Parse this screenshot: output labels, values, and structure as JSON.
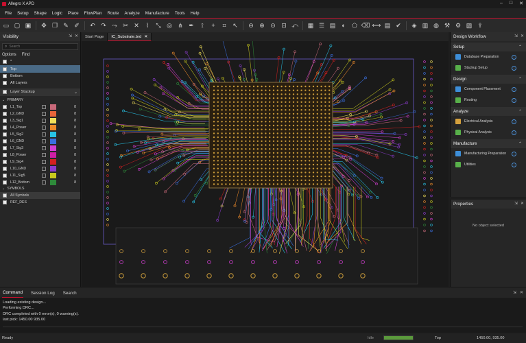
{
  "app": {
    "title": "Allegro X APD"
  },
  "menu": [
    "File",
    "Setup",
    "Shape",
    "Logic",
    "Place",
    "FlowPlan",
    "Route",
    "Analyze",
    "Manufacture",
    "Tools",
    "Help"
  ],
  "toolbar": {
    "icons": [
      "folder-open-icon",
      "new-file-icon",
      "save-icon",
      "move-icon",
      "copy-icon",
      "edit-icon",
      "draw-icon",
      "undo-icon",
      "redo-icon",
      "route-icon",
      "cut-icon",
      "delete-icon",
      "connect-icon",
      "slide-icon",
      "via-icon",
      "spread-icon",
      "pen-icon",
      "fanout-icon",
      "add-icon",
      "snap-icon",
      "cursor-icon",
      "zoom-out-icon",
      "zoom-in-icon",
      "zoom-fit-icon",
      "zoom-window-icon",
      "zoom-previous-icon",
      "grid-icon",
      "layers-icon",
      "film-icon",
      "color-icon",
      "shape-icon",
      "delete-shape-icon",
      "measure-icon",
      "report-icon",
      "drc-icon",
      "3d-icon",
      "chip-icon",
      "palette-icon",
      "tools-icon",
      "settings-icon",
      "script-icon",
      "export-icon"
    ]
  },
  "visibility": {
    "title": "Visibility",
    "search_placeholder": "Search",
    "tabs": [
      "Options",
      "Find"
    ],
    "rows": [
      {
        "label": "*",
        "selected": false
      },
      {
        "label": "Top",
        "selected": true
      },
      {
        "label": "Bottom",
        "selected": false
      },
      {
        "label": "All Layers",
        "selected": false
      }
    ],
    "layer_stackup": "Layer Stackup",
    "primary_label": "PRIMARY",
    "layers": [
      {
        "name": "L1_Top",
        "color": "#c9697a",
        "num": "8"
      },
      {
        "name": "L2_GND",
        "color": "#e8663a",
        "num": "8"
      },
      {
        "name": "L3_Sig1",
        "color": "#f1e05a",
        "num": "8"
      },
      {
        "name": "L4_Power",
        "color": "#ee8b2a",
        "num": "8"
      },
      {
        "name": "L5_Sig2",
        "color": "#27c3e6",
        "num": "8"
      },
      {
        "name": "L6_GND",
        "color": "#3a6fe0",
        "num": "8"
      },
      {
        "name": "L7_Sig3",
        "color": "#d43fd4",
        "num": "8"
      },
      {
        "name": "L8_Power",
        "color": "#cf1ea6",
        "num": "8"
      },
      {
        "name": "L9_Sig4",
        "color": "#d42020",
        "num": "8"
      },
      {
        "name": "L10_GND",
        "color": "#8c3ccf",
        "num": "8"
      },
      {
        "name": "L11_Sig5",
        "color": "#c8c81e",
        "num": "8"
      },
      {
        "name": "L12_Bottom",
        "color": "#2e8a3a",
        "num": "8"
      }
    ],
    "symbols_label": "SYMBOLS",
    "symbols": [
      {
        "name": "All Symbols",
        "selected": true
      },
      {
        "name": "REF_DES",
        "selected": false
      }
    ]
  },
  "doc_tabs": [
    {
      "label": "Start Page",
      "active": false,
      "closable": false
    },
    {
      "label": "IC_Substrate.brd",
      "active": true,
      "closable": true
    }
  ],
  "workflow": {
    "title": "Design Workflow",
    "groups": [
      {
        "label": "Setup",
        "items": [
          "Database Preparation",
          "Stackup Setup"
        ]
      },
      {
        "label": "Design",
        "items": [
          "Component Placement",
          "Routing"
        ]
      },
      {
        "label": "Analyze",
        "items": [
          "Electrical Analysis",
          "Physical Analysis"
        ]
      },
      {
        "label": "Manufacture",
        "items": [
          "Manufacturing Preparation",
          "Utilities"
        ]
      }
    ]
  },
  "properties": {
    "title": "Properties",
    "empty_text": "No object selected"
  },
  "command": {
    "tabs": [
      "Command",
      "Session Log",
      "Search"
    ],
    "lines": [
      "Loading existing design...",
      "Performing DRC...",
      "DRC completed with 0 error(s), 0 warning(s).",
      "last pick:  1450.00  935.00"
    ]
  },
  "status": {
    "text": "Ready",
    "idle": "Idle",
    "progress": 1.0,
    "layer": "Top",
    "coords": "1450.00, 935.00"
  },
  "colors": {
    "accent": "#c8102e",
    "selection": "#4a6a86",
    "info": "#4b8ed4",
    "progress": "#5b9a3c"
  }
}
